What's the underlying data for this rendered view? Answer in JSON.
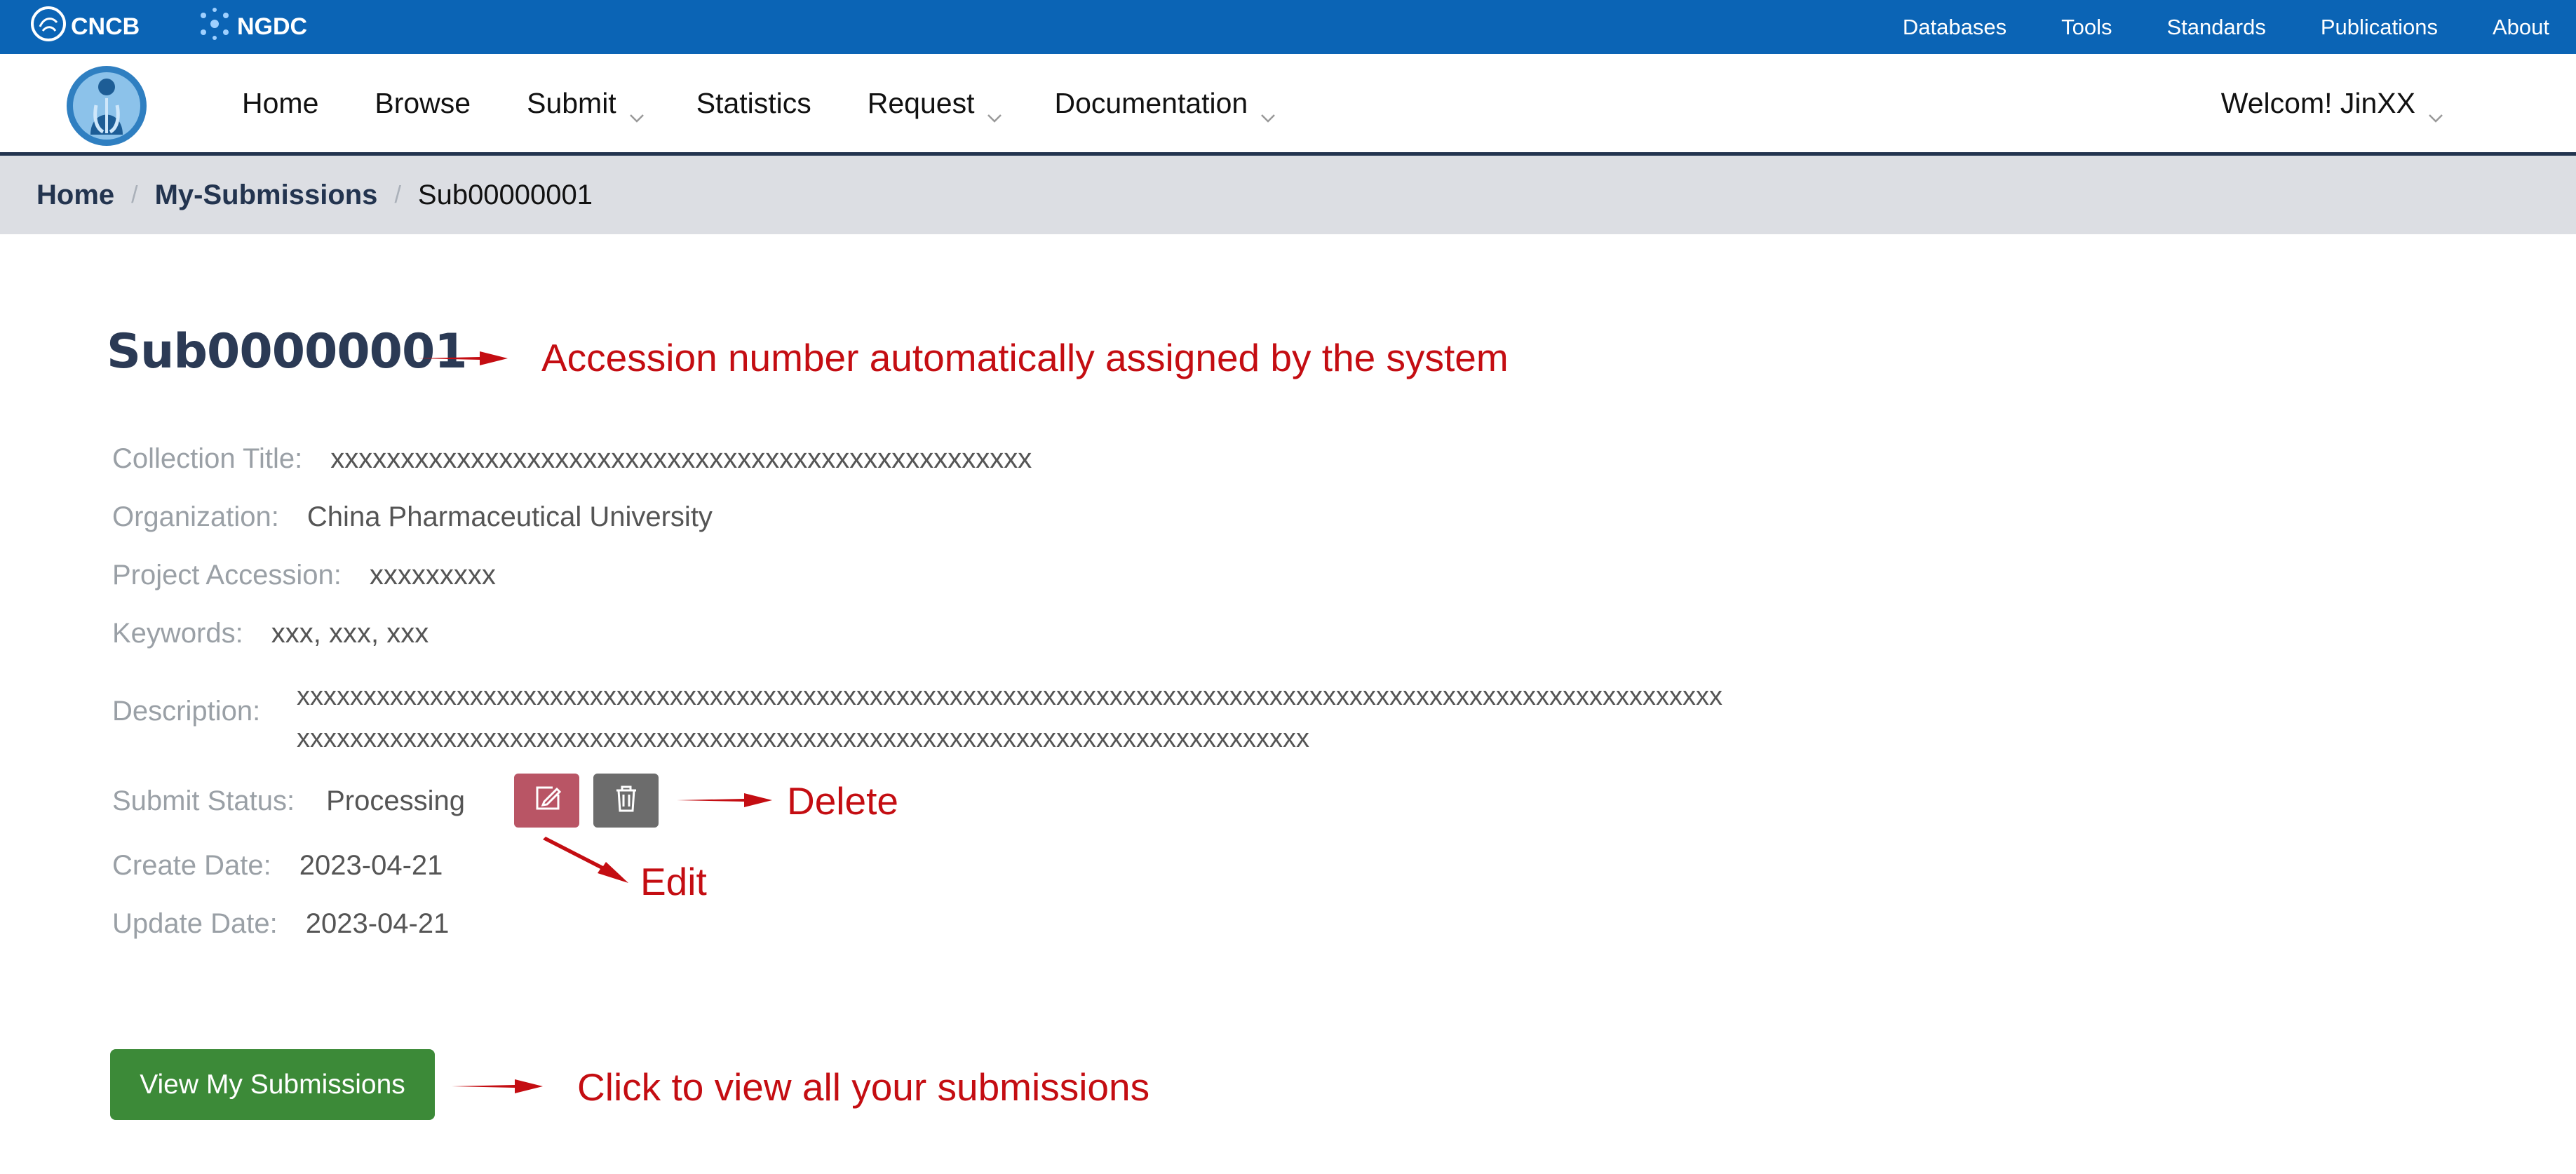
{
  "topbar": {
    "brand_cncb": "CNCB",
    "brand_ngdc": "NGDC",
    "links": [
      "Databases",
      "Tools",
      "Standards",
      "Publications",
      "About"
    ]
  },
  "nav": {
    "items": [
      {
        "label": "Home",
        "dropdown": false
      },
      {
        "label": "Browse",
        "dropdown": false
      },
      {
        "label": "Submit",
        "dropdown": true
      },
      {
        "label": "Statistics",
        "dropdown": false
      },
      {
        "label": "Request",
        "dropdown": true
      },
      {
        "label": "Documentation",
        "dropdown": true
      }
    ],
    "welcome": "Welcom! JinXX"
  },
  "breadcrumb": [
    "Home",
    "My-Submissions",
    "Sub00000001"
  ],
  "submission": {
    "accession": "Sub00000001",
    "fields": {
      "collection_title": {
        "label": "Collection Title:",
        "value": "xxxxxxxxxxxxxxxxxxxxxxxxxxxxxxxxxxxxxxxxxxxxxxxxxx"
      },
      "organization": {
        "label": "Organization:",
        "value": "China Pharmaceutical University"
      },
      "project_accession": {
        "label": "Project Accession:",
        "value": "xxxxxxxxx"
      },
      "keywords": {
        "label": "Keywords:",
        "value": "xxx, xxx, xxx"
      },
      "description": {
        "label": "Description:",
        "line1": "xxxxxxxxxxxxxxxxxxxxxxxxxxxxxxxxxxxxxxxxxxxxxxxxxxxxxxxxxxxxxxxxxxxxxxxxxxxxxxxxxxxxxxxxxxxxxxxxxxxxxxxxxxx",
        "line2": "xxxxxxxxxxxxxxxxxxxxxxxxxxxxxxxxxxxxxxxxxxxxxxxxxxxxxxxxxxxxxxxxxxxxxxxxxxxx"
      },
      "submit_status": {
        "label": "Submit Status:",
        "value": "Processing"
      },
      "create_date": {
        "label": "Create Date:",
        "value": "2023-04-21"
      },
      "update_date": {
        "label": "Update Date:",
        "value": "2023-04-21"
      }
    },
    "view_button": "View My Submissions"
  },
  "annotations": {
    "accession": "Accession number automatically assigned by the system",
    "delete": "Delete",
    "edit": "Edit",
    "view": "Click to view all your submissions",
    "color": "#c40d12"
  },
  "colors": {
    "topbar": "#0b64b5",
    "breadcrumb_bg": "#dcdee3",
    "edit_button": "#b95565",
    "delete_button": "#6c6c6c",
    "view_button": "#3c8a38"
  }
}
